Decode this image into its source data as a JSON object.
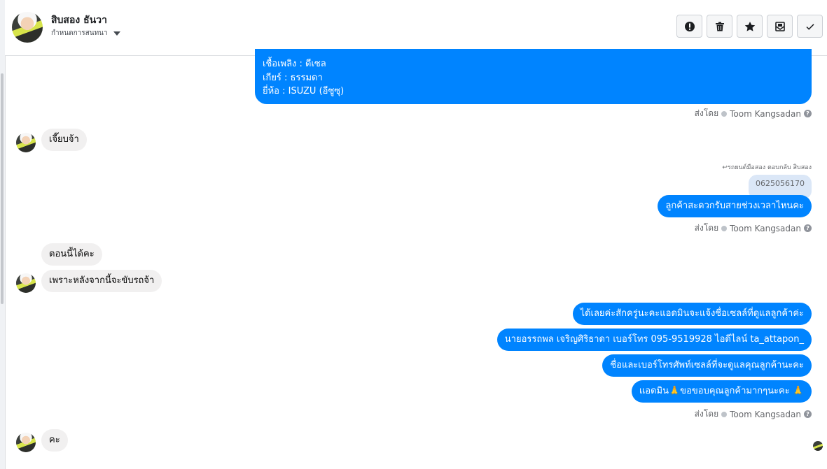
{
  "header": {
    "contact_name": "สิบสอง ธันวา",
    "subtitle": "กำหนดการสนทนา",
    "actions": [
      {
        "name": "report",
        "icon": "alert-circle-icon"
      },
      {
        "name": "delete",
        "icon": "trash-icon"
      },
      {
        "name": "star",
        "icon": "star-icon"
      },
      {
        "name": "mark-unread",
        "icon": "envelope-icon"
      },
      {
        "name": "done",
        "icon": "check-icon"
      }
    ]
  },
  "messages": {
    "first_block": {
      "lines": [
        "เชื้อเพลิง : ดีเซล",
        "เกียร์ : ธรรมดา",
        "ยี่ห้อ : ISUZU (อีซูซุ)"
      ]
    },
    "sent_by_prefix": "ส่งโดย",
    "sender_name": "Toom Kangsadan",
    "in_1": "เจี๊ยบจ้า",
    "reply_label": "↩รถยนต์มือสอง ตอบกลับ สิบสอง",
    "reply_quote": "0625056170",
    "out_2": "ลูกค้าสะดวกรับสายช่วงเวลาไหนคะ",
    "in_2a": "ตอนนี้ได้คะ",
    "in_2b": "เพราะหลังจากนี้จะขับรถจ้า",
    "out_3a": "ได้เลยค่ะสักครู่นะคะแอดมินจะแจ้งชื่อเซลล์ที่ดูแลลูกค้าค่ะ",
    "out_3b": "นายอรรถพล เจริญศิริธาดา     เบอร์โทร 095-9519928 ไอดีไลน์ ta_attapon_",
    "out_3c": "ชื่อและเบอร์โทรศัพท์เซลล์ที่จะดูแลคุณลูกค้านะคะ",
    "out_3d": "แอดมิน🙏ขอขอบคุณลูกค้ามากๆนะคะ 🙏",
    "in_3": "คะ"
  },
  "colors": {
    "outgoing_bubble": "#0084ff",
    "incoming_bubble": "#f1f0f0",
    "reply_quote_bg": "#dbe7f7"
  }
}
